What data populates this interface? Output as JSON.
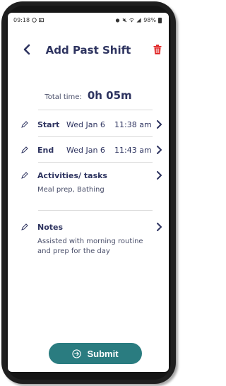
{
  "status_bar": {
    "time": "09:18",
    "battery": "98%"
  },
  "header": {
    "title": "Add Past Shift"
  },
  "total": {
    "label": "Total time:",
    "value": "0h 05m"
  },
  "start": {
    "label": "Start",
    "date": "Wed Jan 6",
    "time": "11:38 am"
  },
  "end": {
    "label": "End",
    "date": "Wed Jan 6",
    "time": "11:43 am"
  },
  "activities": {
    "label": "Activities/ tasks",
    "value": "Meal prep, Bathing"
  },
  "notes": {
    "label": "Notes",
    "value": "Assisted with morning routine and prep for the day"
  },
  "submit": {
    "label": "Submit"
  },
  "colors": {
    "accent": "#2a7c80",
    "title": "#2e3460",
    "delete": "#e02020"
  },
  "icons": [
    "back-chevron-icon",
    "trash-icon",
    "pencil-icon",
    "chevron-right-icon",
    "arrow-circle-right-icon"
  ]
}
